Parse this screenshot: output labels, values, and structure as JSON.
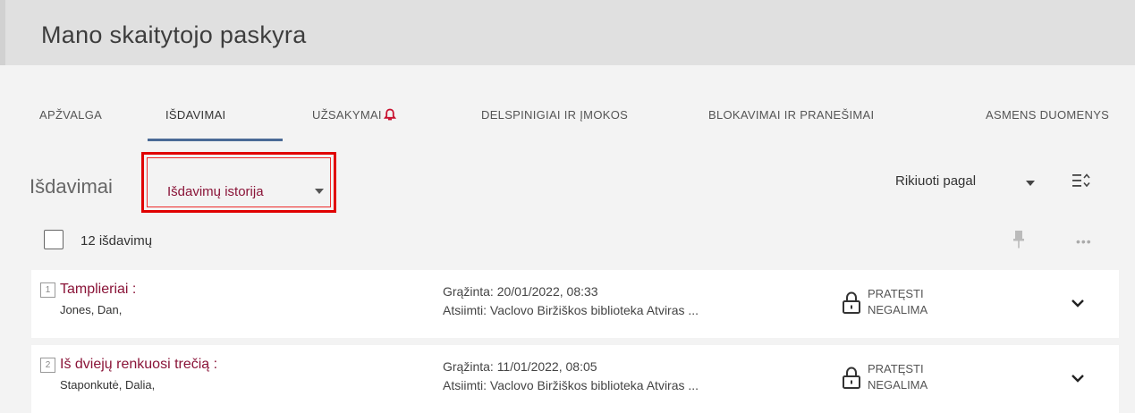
{
  "header": {
    "title": "Mano skaitytojo paskyra"
  },
  "tabs": [
    {
      "label": "APŽVALGA"
    },
    {
      "label": "IŠDAVIMAI"
    },
    {
      "label": "UŽSAKYMAI"
    },
    {
      "label": "DELSPINIGIAI IR ĮMOKOS"
    },
    {
      "label": "BLOKAVIMAI IR PRANEŠIMAI"
    },
    {
      "label": "ASMENS DUOMENYS"
    }
  ],
  "active_tab": "IŠDAVIMAI",
  "section": {
    "title": "Išdavimai",
    "filter_selected": "Išdavimų istorija",
    "sort_label": "Rikiuoti pagal"
  },
  "list": {
    "count_label": "12 išdavimų"
  },
  "items": [
    {
      "number": "1",
      "title": "Tamplieriai :",
      "author": "Jones, Dan,",
      "returned": "Grąžinta: 20/01/2022, 08:33",
      "pickup": "Atsiimti: Vaclovo Biržiškos biblioteka Atviras ...",
      "renew_line1": "PRATĘSTI",
      "renew_line2": "NEGALIMA"
    },
    {
      "number": "2",
      "title": "Iš dviejų renkuosi trečią :",
      "author": "Staponkutė, Dalia,",
      "returned": "Grąžinta: 11/01/2022, 08:05",
      "pickup": "Atsiimti: Vaclovo Biržiškos biblioteka Atviras ...",
      "renew_line1": "PRATĘSTI",
      "renew_line2": "NEGALIMA"
    }
  ],
  "colors": {
    "accent": "#8a1438",
    "tab_underline": "#4a6a96",
    "highlight_box": "#e00000",
    "notification_bell": "#c8102e"
  },
  "icons": [
    "bell-icon",
    "dropdown-caret-icon",
    "sort-toggle-icon",
    "pin-icon",
    "more-icon",
    "lock-icon",
    "chevron-down-icon"
  ]
}
